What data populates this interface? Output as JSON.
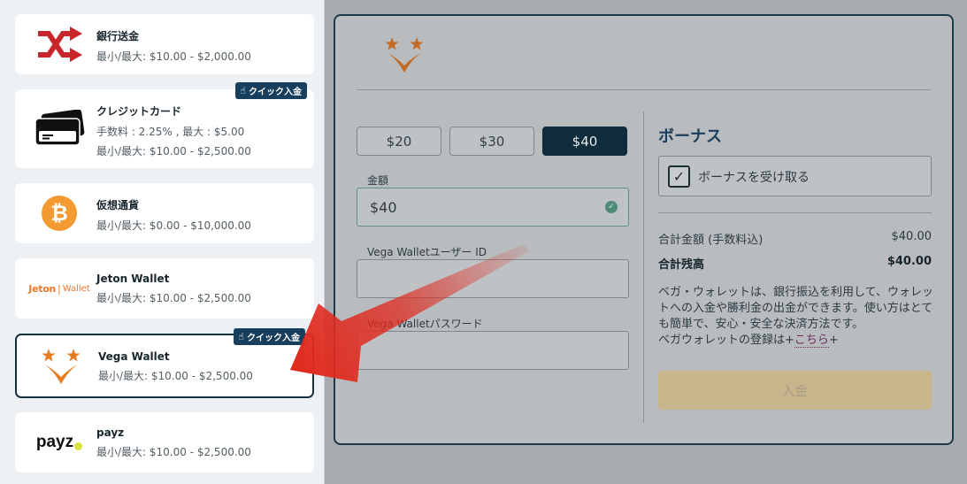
{
  "payment_methods": [
    {
      "name": "銀行送金",
      "lines": [
        "最小/最大: $10.00 - $2,000.00"
      ],
      "logo": "shuffle-arrows-icon"
    },
    {
      "name": "クレジットカード",
      "lines": [
        "手数料 : 2.25% , 最大 : $5.00",
        "最小/最大: $10.00 - $2,500.00"
      ],
      "logo": "credit-card-icon",
      "badge": "クイック入金"
    },
    {
      "name": "仮想通貨",
      "lines": [
        "最小/最大: $0.00 - $10,000.00"
      ],
      "logo": "bitcoin-icon",
      "logo_symbol": "₿"
    },
    {
      "name": "Jeton Wallet",
      "lines": [
        "最小/最大: $10.00 - $2,500.00"
      ],
      "logo": "jeton-logo",
      "logo_text_main": "Jeton",
      "logo_text_sub": "Wallet"
    },
    {
      "name": "Vega Wallet",
      "lines": [
        "最小/最大: $10.00 - $2,500.00"
      ],
      "logo": "vega-logo",
      "badge": "クイック入金",
      "selected": true
    },
    {
      "name": "payz",
      "lines": [
        "最小/最大: $10.00 - $2,500.00"
      ],
      "logo": "payz-logo",
      "logo_text": "payz"
    }
  ],
  "form": {
    "amount_options": [
      "$20",
      "$30",
      "$40"
    ],
    "selected_amount": "$40",
    "amount_label": "金額",
    "amount_value": "$40",
    "user_id_label": "Vega Walletユーザー ID",
    "user_id_value": "",
    "password_label": "Vega Walletパスワード",
    "password_value": ""
  },
  "bonus": {
    "title": "ボーナス",
    "checkbox_label": "ボーナスを受け取る",
    "checked": true
  },
  "summary": {
    "total_label": "合計金額 (手数料込)",
    "total_value": "$40.00",
    "balance_label": "合計残高",
    "balance_value": "$40.00"
  },
  "description": {
    "text": "ベガ・ウォレットは、銀行振込を利用して、ウォレットへの入金や勝利金の出金ができます。使い方はとても簡単で、安心・安全な決済方法です。",
    "register_prefix": "ベガウォレットの登録は+",
    "register_link": "こちら",
    "register_suffix": "+"
  },
  "submit_label": "入金",
  "colors": {
    "accent_dark": "#0f2c3d",
    "badge": "#173f5d",
    "brand_orange": "#e57c1f",
    "arrow_red": "#e02b1f",
    "submit": "#c9b58c"
  }
}
